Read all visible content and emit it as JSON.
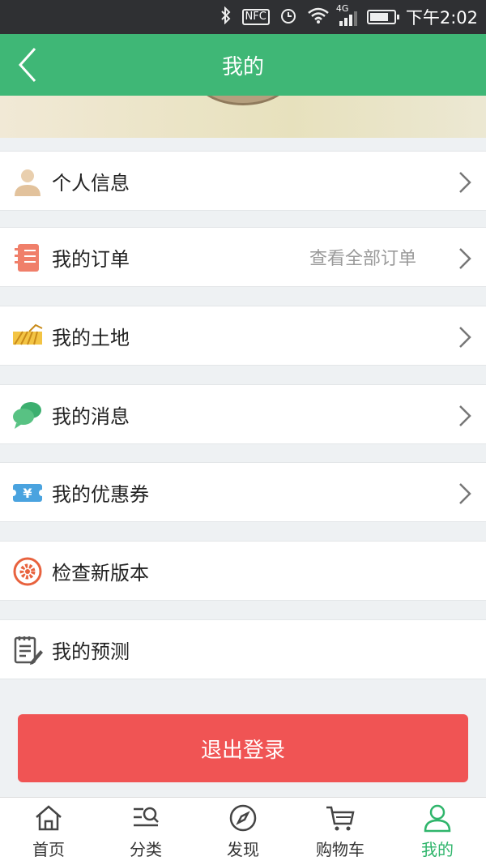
{
  "status_bar": {
    "icons": [
      "bluetooth-icon",
      "nfc-icon",
      "alarm-icon",
      "wifi-icon",
      "signal-4g-icon",
      "battery-icon"
    ],
    "nfc_text": "NFC",
    "network_text": "4G",
    "time": "下午2:02"
  },
  "header": {
    "title": "我的",
    "back_icon": "chevron-left-icon"
  },
  "menu": {
    "items": [
      {
        "label": "个人信息",
        "icon": "person-icon"
      },
      {
        "label": "我的订单",
        "icon": "notebook-icon",
        "hint": "查看全部订单"
      },
      {
        "label": "我的土地",
        "icon": "field-icon"
      },
      {
        "label": "我的消息",
        "icon": "chat-bubble-icon"
      },
      {
        "label": "我的优惠券",
        "icon": "coupon-icon",
        "coupon_symbol": "¥"
      },
      {
        "label": "检查新版本",
        "icon": "update-gear-icon"
      },
      {
        "label": "我的预测",
        "icon": "forecast-note-icon"
      }
    ]
  },
  "logout_label": "退出登录",
  "tab_bar": {
    "tabs": [
      {
        "label": "首页",
        "icon": "home-icon"
      },
      {
        "label": "分类",
        "icon": "category-search-icon"
      },
      {
        "label": "发现",
        "icon": "compass-icon"
      },
      {
        "label": "购物车",
        "icon": "cart-icon"
      },
      {
        "label": "我的",
        "icon": "user-icon",
        "active": true
      }
    ]
  },
  "colors": {
    "header_green": "#3fb776",
    "active_tab": "#2fb56b",
    "logout_red": "#f05454"
  }
}
